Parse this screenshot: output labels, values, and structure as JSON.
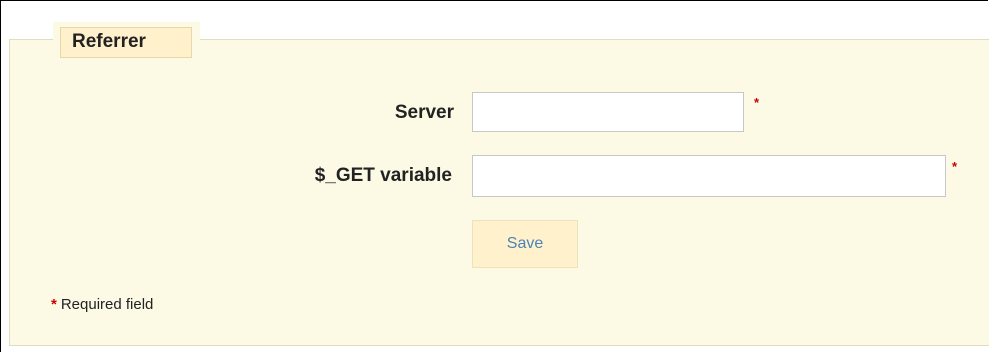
{
  "fieldset": {
    "legend": "Referrer"
  },
  "form": {
    "server_label": "Server",
    "server_value": "",
    "get_variable_label": "$_GET variable",
    "get_variable_value": "",
    "required_marker": "*",
    "save_label": "Save"
  },
  "footer": {
    "required_star": "*",
    "required_note": "Required field"
  },
  "colors": {
    "panel_background": "#fcfae5",
    "legend_background": "#fff1cc",
    "required_star": "#cc0000",
    "save_text": "#4a84b8"
  }
}
